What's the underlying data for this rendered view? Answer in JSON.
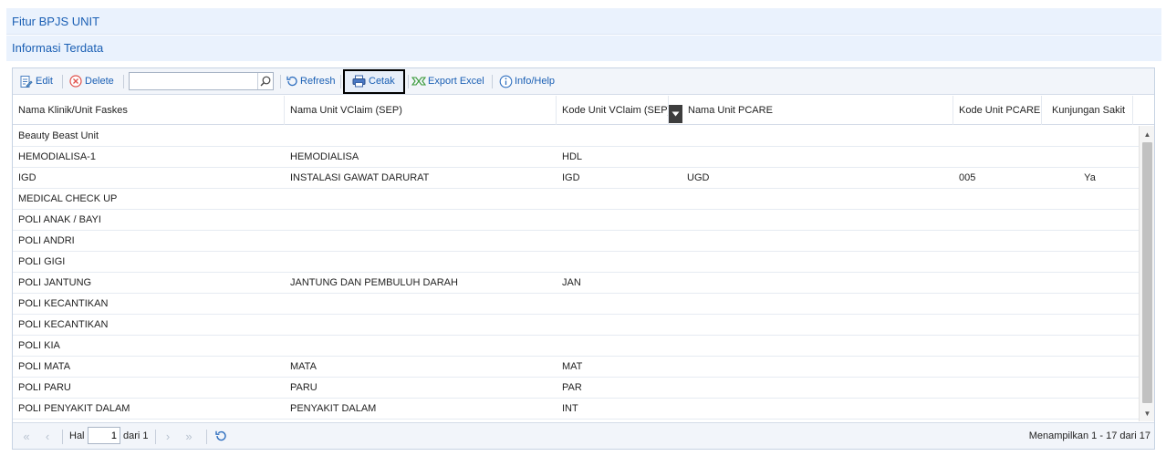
{
  "page": {
    "title": "Fitur BPJS UNIT",
    "subtitle": "Informasi Terdata"
  },
  "toolbar": {
    "edit_label": "Edit",
    "delete_label": "Delete",
    "search_value": "",
    "refresh_label": "Refresh",
    "cetak_label": "Cetak",
    "export_label": "Export Excel",
    "info_label": "Info/Help"
  },
  "columns": [
    "Nama Klinik/Unit Faskes",
    "Nama Unit VClaim (SEP)",
    "Kode Unit VClaim (SEP)",
    "Nama Unit PCARE",
    "Kode Unit PCARE",
    "Kunjungan Sakit"
  ],
  "rows": [
    [
      "Beauty Beast Unit",
      "",
      "",
      "",
      "",
      ""
    ],
    [
      "HEMODIALISA-1",
      "HEMODIALISA",
      "HDL",
      "",
      "",
      ""
    ],
    [
      "IGD",
      "INSTALASI GAWAT DARURAT",
      "IGD",
      "UGD",
      "005",
      "Ya"
    ],
    [
      "MEDICAL CHECK UP",
      "",
      "",
      "",
      "",
      ""
    ],
    [
      "POLI ANAK / BAYI",
      "",
      "",
      "",
      "",
      ""
    ],
    [
      "POLI ANDRI",
      "",
      "",
      "",
      "",
      ""
    ],
    [
      "POLI GIGI",
      "",
      "",
      "",
      "",
      ""
    ],
    [
      "POLI JANTUNG",
      "JANTUNG DAN PEMBULUH DARAH",
      "JAN",
      "",
      "",
      ""
    ],
    [
      "POLI KECANTIKAN",
      "",
      "",
      "",
      "",
      ""
    ],
    [
      "POLI KECANTIKAN",
      "",
      "",
      "",
      "",
      ""
    ],
    [
      "POLI KIA",
      "",
      "",
      "",
      "",
      ""
    ],
    [
      "POLI MATA",
      "MATA",
      "MAT",
      "",
      "",
      ""
    ],
    [
      "POLI PARU",
      "PARU",
      "PAR",
      "",
      "",
      ""
    ],
    [
      "POLI PENYAKIT DALAM",
      "PENYAKIT DALAM",
      "INT",
      "",
      "",
      ""
    ]
  ],
  "pager": {
    "hal_label": "Hal",
    "page_value": "1",
    "of_label": "dari 1",
    "info": "Menampilkan 1 - 17 dari 17"
  },
  "colors": {
    "accent": "#1a5fb4",
    "header_bg": "#eaf2fd",
    "toolbar_bg": "#f2f5fa"
  }
}
